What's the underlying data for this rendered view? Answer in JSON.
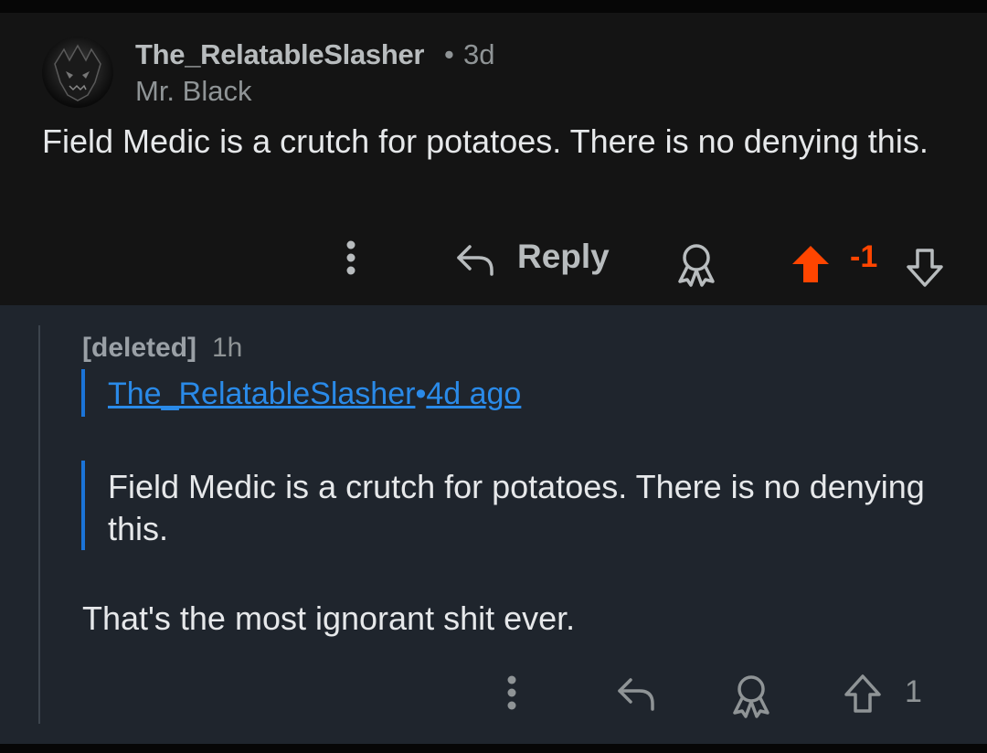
{
  "parent_comment": {
    "username": "The_RelatableSlasher",
    "separator": "•",
    "age": "3d",
    "flair": "Mr. Black",
    "body": "Field Medic is a crutch for potatoes. There is no denying this.",
    "actions": {
      "more_icon": "more-vertical-icon",
      "reply_icon": "reply-arrow-icon",
      "reply_label": "Reply",
      "award_icon": "award-icon",
      "upvote_icon": "upvote-arrow-icon",
      "upvote_state": "upvoted",
      "vote_count": "-1",
      "downvote_icon": "downvote-arrow-icon"
    }
  },
  "reply_comment": {
    "username": "[deleted]",
    "age": "1h",
    "quote_header": {
      "username": "The_RelatableSlasher",
      "separator": "•",
      "age": "4d ago"
    },
    "quote_text": "Field Medic is a crutch for potatoes. There is no denying this.",
    "body": "That's the most ignorant shit ever.",
    "actions": {
      "more_icon": "more-vertical-icon",
      "reply_icon": "reply-arrow-icon",
      "award_icon": "award-icon",
      "upvote_icon": "upvote-arrow-icon",
      "vote_count": "1"
    }
  },
  "colors": {
    "parent_background": "#141414",
    "reply_background": "#1f252d",
    "upvote_accent": "#ff4500",
    "link_blue": "#2a8ae8",
    "quote_bar": "#1b74d8"
  }
}
